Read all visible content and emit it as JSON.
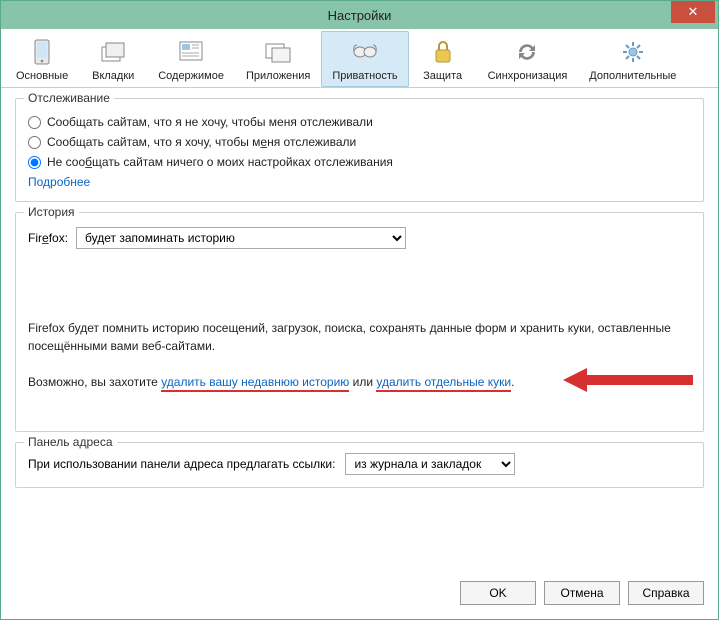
{
  "window": {
    "title": "Настройки",
    "close": "✕"
  },
  "tabs": [
    {
      "label": "Основные",
      "name": "tab-general"
    },
    {
      "label": "Вкладки",
      "name": "tab-tabs"
    },
    {
      "label": "Содержимое",
      "name": "tab-content"
    },
    {
      "label": "Приложения",
      "name": "tab-applications"
    },
    {
      "label": "Приватность",
      "name": "tab-privacy",
      "active": true
    },
    {
      "label": "Защита",
      "name": "tab-security"
    },
    {
      "label": "Синхронизация",
      "name": "tab-sync"
    },
    {
      "label": "Дополнительные",
      "name": "tab-advanced"
    }
  ],
  "tracking": {
    "title": "Отслеживание",
    "opt1": "Сообщать сайтам, что я не хочу, чтобы меня отслеживали",
    "opt2": "Сообщать сайтам, что я хочу, чтобы меня отслеживали",
    "opt3": "Не сообщать сайтам ничего о моих настройках отслеживания",
    "selected": "opt3",
    "more": "Подробнее"
  },
  "history": {
    "title": "История",
    "label": "Firefox:",
    "select_value": "будет запоминать историю",
    "info": "Firefox будет помнить историю посещений, загрузок, поиска, сохранять данные форм и хранить куки, оставленные посещёнными вами веб-сайтами.",
    "action_prefix": "Возможно, вы захотите ",
    "link1": "удалить вашу недавнюю историю",
    "mid": " или ",
    "link2": "удалить отдельные куки",
    "suffix": "."
  },
  "addressbar": {
    "title": "Панель адреса",
    "label": "При использовании панели адреса предлагать ссылки:",
    "select_value": "из журнала и закладок"
  },
  "buttons": {
    "ok": "OK",
    "cancel": "Отмена",
    "help": "Справка"
  }
}
